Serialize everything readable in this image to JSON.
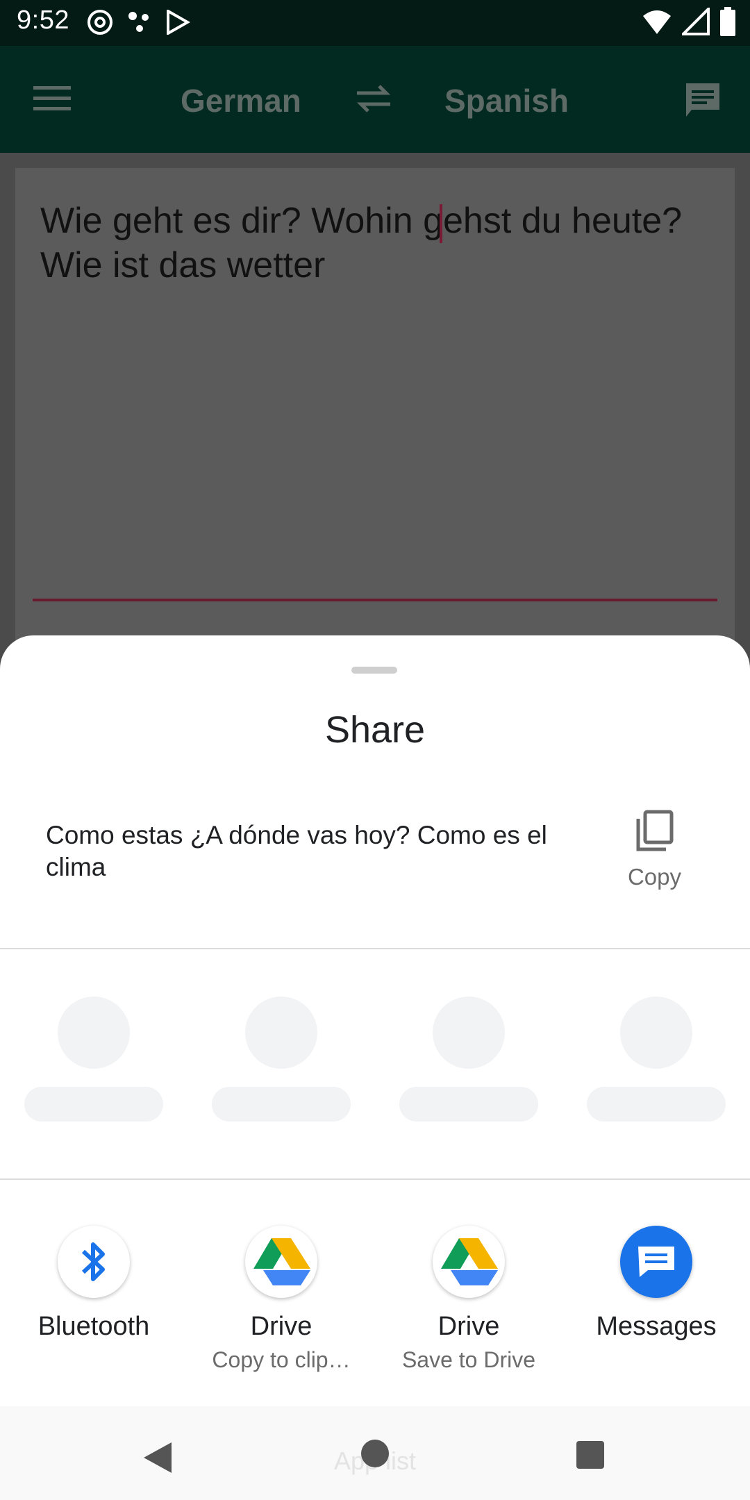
{
  "status_bar": {
    "time": "9:52"
  },
  "app": {
    "source_language": "German",
    "target_language": "Spanish",
    "input_text": "Wie geht es dir? Wohin gehst du heute? Wie ist das wetter"
  },
  "share_sheet": {
    "title": "Share",
    "preview_text": "Como estas ¿A dónde vas hoy? Como es el clima",
    "copy_label": "Copy",
    "targets": [
      {
        "name": "Bluetooth",
        "subtitle": "",
        "icon": "bluetooth-icon"
      },
      {
        "name": "Drive",
        "subtitle": "Copy to clip…",
        "icon": "google-drive-icon"
      },
      {
        "name": "Drive",
        "subtitle": "Save to Drive",
        "icon": "google-drive-icon"
      },
      {
        "name": "Messages",
        "subtitle": "",
        "icon": "messages-icon"
      }
    ]
  },
  "nav_bar": {
    "ghost_label": "App list"
  },
  "colors": {
    "status_bar": "#041a14",
    "app_bar_dimmed": "#032a21",
    "accent_underline": "#6a1a2e",
    "messages_blue": "#1a73e8",
    "bluetooth_blue": "#1a73e8"
  }
}
